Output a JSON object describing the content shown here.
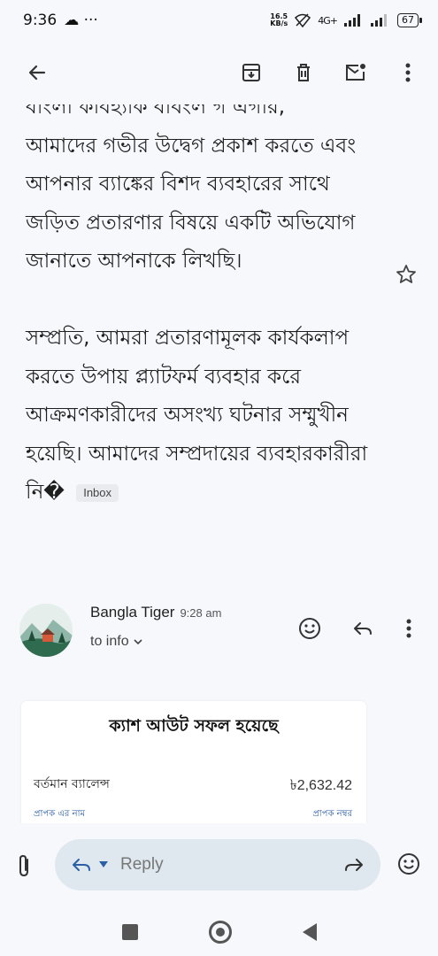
{
  "status_bar": {
    "time": "9:36",
    "left_extras": "☁ ···",
    "speed_value": "16.5",
    "speed_unit": "KB/s",
    "network": "4G+",
    "battery": "67"
  },
  "toolbar": {
    "back_icon": "arrow-left-icon",
    "archive_icon": "archive-icon",
    "delete_icon": "trash-icon",
    "unread_icon": "mark-unread-icon",
    "more_icon": "more-vert-icon"
  },
  "email": {
    "partial_top_line": "বাংলা কাবহ্যাক বাবংল গ এগার,",
    "paragraph1": "আমাদের গভীর উদ্বেগ প্রকাশ করতে এবং আপনার ব্যাঙ্কের বিশদ ব্যবহারের সাথে জড়িত প্রতারণার বিষয়ে একটি অভিযোগ জানাতে আপনাকে লিখছি।",
    "paragraph2": "সম্প্রতি, আমরা প্রতারণামূলক কার্যকলাপ করতে উপায় প্ল্যাটফর্ম ব্যবহার করে আক্রমণকারীদের অসংখ্য ঘটনার সম্মুখীন হয়েছি। আমাদের সম্প্রদায়ের ব্যবহারকারীরা নি�",
    "label_chip": "Inbox"
  },
  "sender": {
    "name": "Bangla Tiger",
    "time": "9:28 am",
    "recipient": "to info",
    "recipient_chevron": "⌄"
  },
  "card": {
    "title": "ক্যাশ আউট সফল হয়েছে",
    "balance_label": "বর্তমান ব্যালেন্স",
    "balance_value": "৳2,632.42",
    "recipient_name_label": "প্রাপক এর নাম",
    "recipient_number_label": "প্রাপক নম্বর"
  },
  "reply_bar": {
    "placeholder": "Reply"
  },
  "colors": {
    "background": "#f6f8fc",
    "reply_pill": "#dfe8ee",
    "link_blue": "#2b5fa6"
  }
}
